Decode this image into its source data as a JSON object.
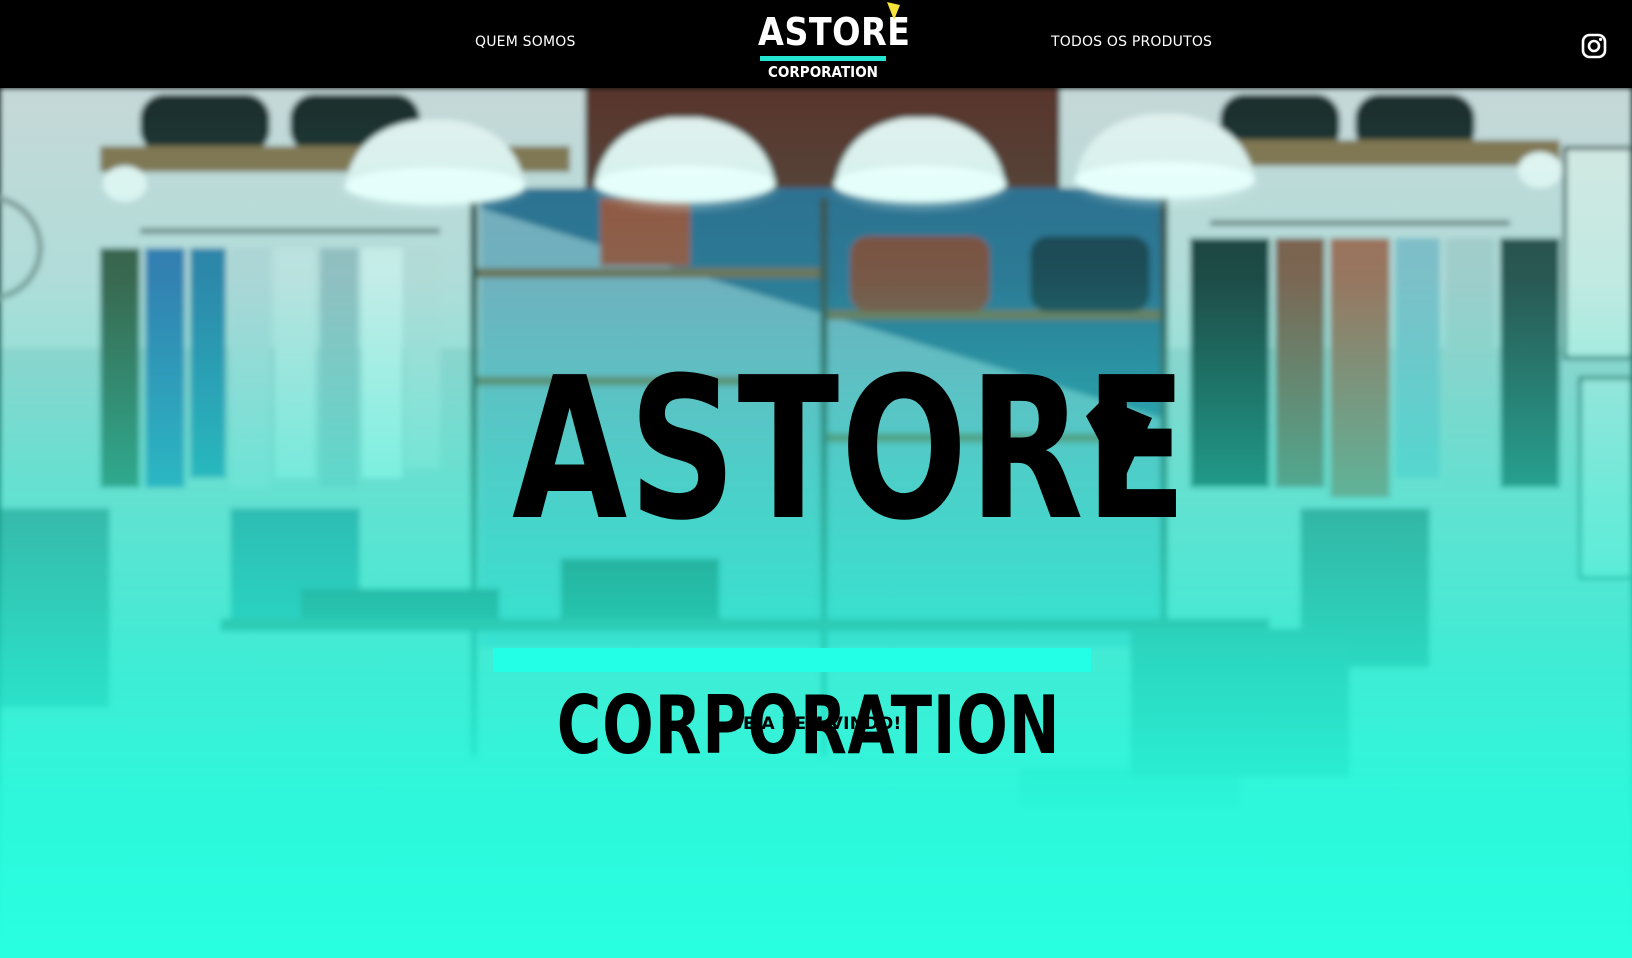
{
  "header": {
    "nav_left": "QUEM SOMOS",
    "nav_right": "TODOS OS PRODUTOS",
    "logo_word": "ASTORE",
    "logo_sub": "CORPORATION",
    "logo_mark_icon": "yellow-diamond-mark",
    "social_icon": "instagram-icon"
  },
  "hero": {
    "background": "clothing-store-interior-photo",
    "title": "ASTORE",
    "subtitle": "CORPORATION",
    "welcome": "SEJA BEM-VINDO!"
  },
  "colors": {
    "header_bg": "#000000",
    "accent": "#23e6d2",
    "mark_yellow": "#f7e23a",
    "overlay": "#28ffe1"
  }
}
